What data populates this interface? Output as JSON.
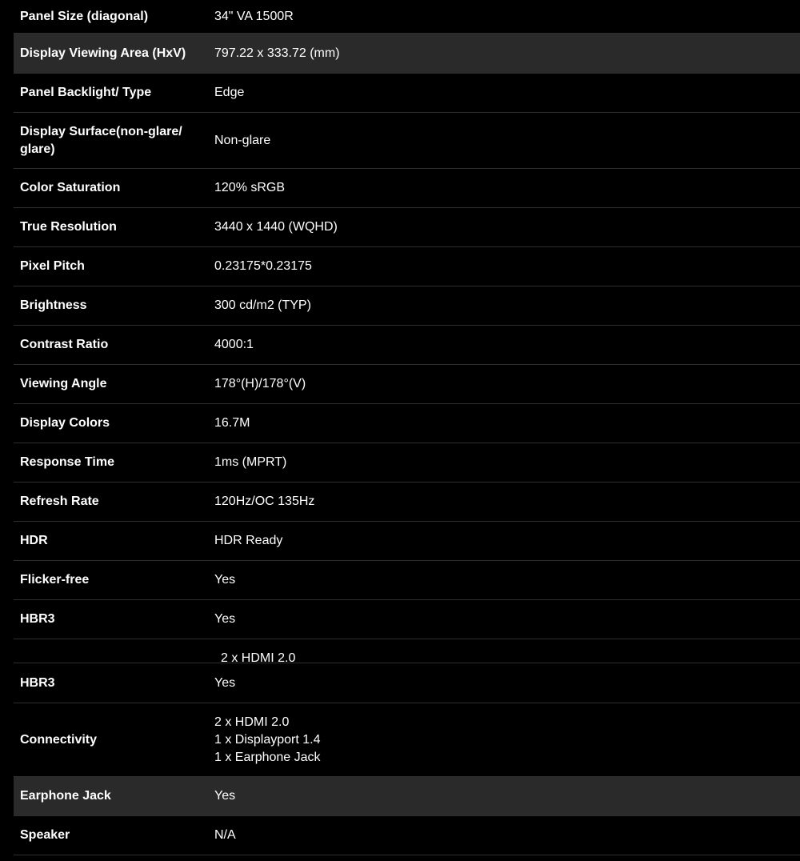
{
  "specs": {
    "rows": [
      {
        "label": "Panel Size (diagonal)",
        "value": "34\" VA 1500R"
      },
      {
        "label": "Display Viewing Area (HxV)",
        "value": "797.22 x 333.72 (mm)"
      },
      {
        "label": "Panel Backlight/ Type",
        "value": "Edge"
      },
      {
        "label": "Display Surface(non-glare/ glare)",
        "value": "Non-glare"
      },
      {
        "label": "Color Saturation",
        "value": "120% sRGB"
      },
      {
        "label": "True Resolution",
        "value": "3440 x 1440 (WQHD)"
      },
      {
        "label": "Pixel Pitch",
        "value": "0.23175*0.23175"
      },
      {
        "label": "Brightness",
        "value": "300 cd/m2 (TYP)"
      },
      {
        "label": "Contrast Ratio",
        "value": "4000:1"
      },
      {
        "label": "Viewing Angle",
        "value": "178°(H)/178°(V)"
      },
      {
        "label": "Display Colors",
        "value": "16.7M"
      },
      {
        "label": "Response Time",
        "value": "1ms (MPRT)"
      },
      {
        "label": "Refresh Rate",
        "value": "120Hz/OC 135Hz"
      },
      {
        "label": "HDR",
        "value": "HDR Ready"
      },
      {
        "label": "Flicker-free",
        "value": "Yes"
      },
      {
        "label": "HBR3",
        "value": "Yes"
      }
    ],
    "clipped_value": "2 x HDMI 2.0",
    "rows_after": [
      {
        "label": "HBR3",
        "value": "Yes"
      },
      {
        "label": "Connectivity",
        "values": [
          "2 x HDMI 2.0",
          "1 x Displayport 1.4",
          "1 x Earphone Jack"
        ]
      },
      {
        "label": "Earphone Jack",
        "value": "Yes"
      },
      {
        "label": "Speaker",
        "value": "N/A"
      }
    ]
  }
}
